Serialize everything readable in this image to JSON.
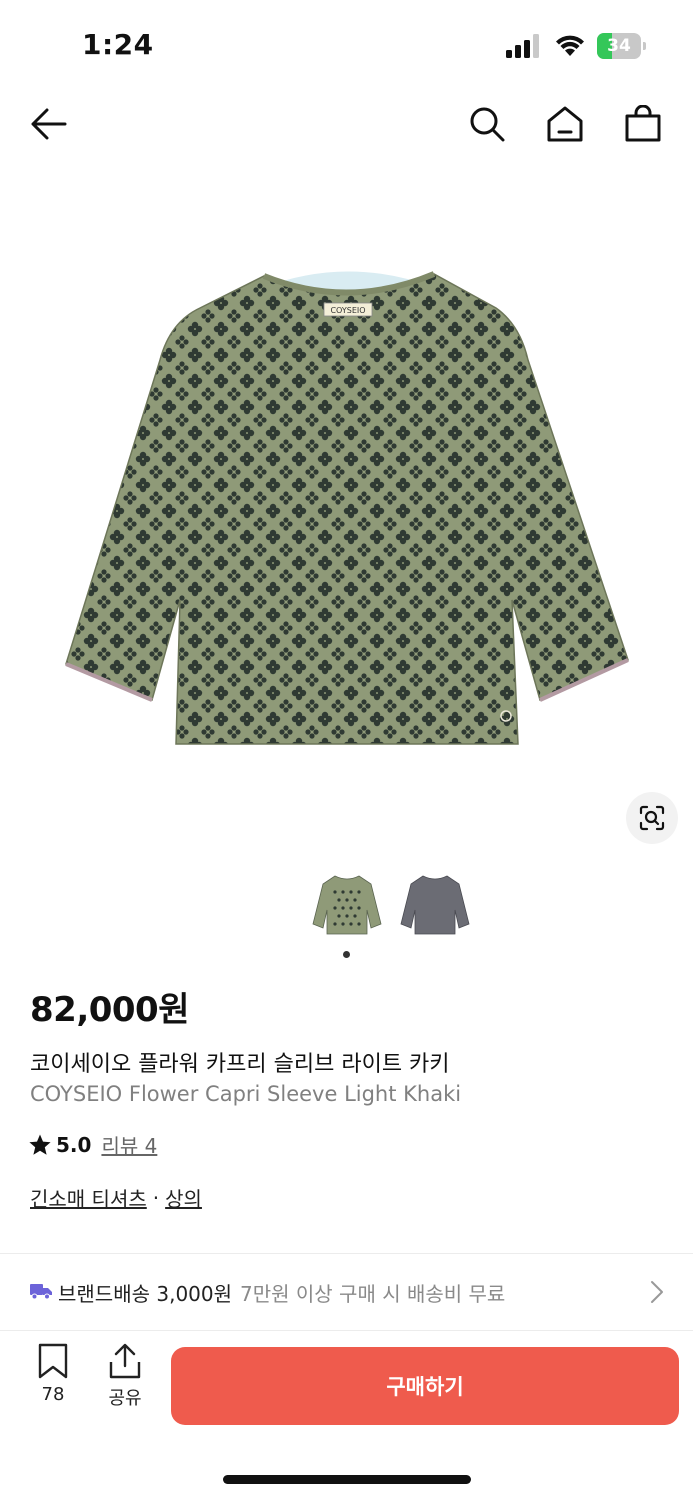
{
  "status_bar": {
    "time": "1:24",
    "battery_percent": 34,
    "battery_label": "34",
    "signal_icon": "cellular-signal-icon",
    "wifi_icon": "wifi-icon",
    "battery_color": "#34c759"
  },
  "nav": {
    "back_icon": "arrow-left-icon",
    "search_icon": "search-icon",
    "home_icon": "home-icon",
    "cart_icon": "shopping-bag-icon"
  },
  "product": {
    "image_brand_tag": "COYSEIO",
    "thumbnails": [
      {
        "color": "khaki",
        "hex": "#8f9a78",
        "selected": true
      },
      {
        "color": "gray",
        "hex": "#6b6c74",
        "selected": false
      }
    ],
    "current_image_page": 1,
    "price": "82,000원",
    "name_ko": "코이세이오 플라워 카프리 슬리브 라이트 카키",
    "name_en": "COYSEIO Flower Capri Sleeve Light Khaki",
    "rating_score": "5.0",
    "review_link": "리뷰 4",
    "category_1": "긴소매 티셔츠",
    "category_separator": "·",
    "category_2": "상의"
  },
  "shipping": {
    "label": "브랜드배송 3,000원",
    "note": "7만원 이상 구매 시 배송비 무료",
    "icon": "truck-icon",
    "accent": "#6c63d9"
  },
  "bottom_bar": {
    "bookmark_count": "78",
    "share_label": "공유",
    "buy_label": "구매하기",
    "buy_color": "#ef5b4d"
  }
}
